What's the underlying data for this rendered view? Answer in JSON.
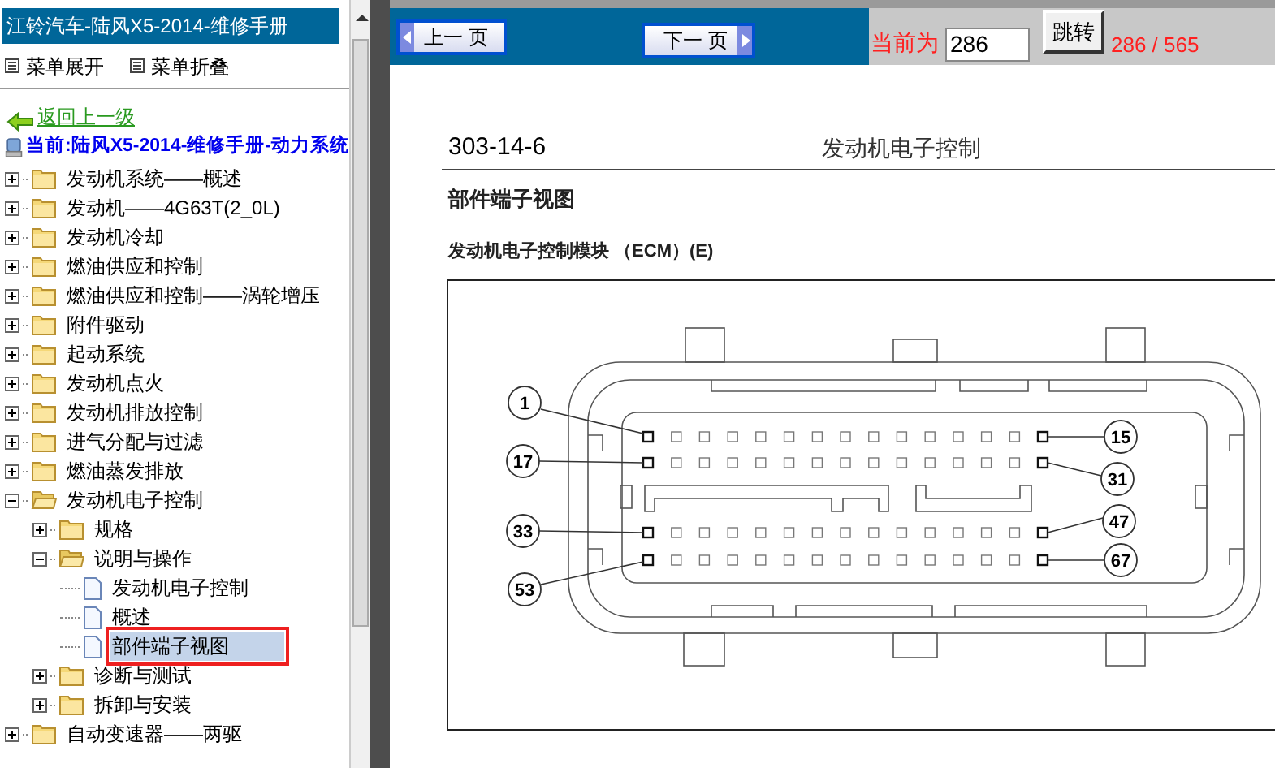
{
  "sidebar": {
    "title": "江铃汽车-陆风X5-2014-维修手册",
    "menu_actions": [
      {
        "label": "菜单展开"
      },
      {
        "label": "菜单折叠"
      }
    ],
    "back_link": "返回上一级",
    "current": "当前:陆风X5-2014-维修手册-动力系统",
    "tree": [
      {
        "kind": "folder",
        "label": "发动机系统——概述",
        "expanded": false,
        "selected": false
      },
      {
        "kind": "folder",
        "label": "发动机——4G63T(2_0L)",
        "expanded": false,
        "selected": false
      },
      {
        "kind": "folder",
        "label": "发动机冷却",
        "expanded": false,
        "selected": false
      },
      {
        "kind": "folder",
        "label": "燃油供应和控制",
        "expanded": false,
        "selected": false
      },
      {
        "kind": "folder",
        "label": "燃油供应和控制——涡轮增压",
        "expanded": false,
        "selected": false
      },
      {
        "kind": "folder",
        "label": "附件驱动",
        "expanded": false,
        "selected": false
      },
      {
        "kind": "folder",
        "label": "起动系统",
        "expanded": false,
        "selected": false
      },
      {
        "kind": "folder",
        "label": "发动机点火",
        "expanded": false,
        "selected": false
      },
      {
        "kind": "folder",
        "label": "发动机排放控制",
        "expanded": false,
        "selected": false
      },
      {
        "kind": "folder",
        "label": "进气分配与过滤",
        "expanded": false,
        "selected": false
      },
      {
        "kind": "folder",
        "label": "燃油蒸发排放",
        "expanded": false,
        "selected": false
      },
      {
        "kind": "folder",
        "label": "发动机电子控制",
        "expanded": true,
        "selected": false,
        "children": [
          {
            "kind": "folder",
            "label": "规格",
            "expanded": false,
            "selected": false
          },
          {
            "kind": "folder",
            "label": "说明与操作",
            "expanded": true,
            "selected": false,
            "children": [
              {
                "kind": "document",
                "label": "发动机电子控制",
                "selected": false
              },
              {
                "kind": "document",
                "label": "概述",
                "selected": false
              },
              {
                "kind": "document",
                "label": "部件端子视图",
                "selected": true
              }
            ]
          },
          {
            "kind": "folder",
            "label": "诊断与测试",
            "expanded": false,
            "selected": false
          },
          {
            "kind": "folder",
            "label": "拆卸与安装",
            "expanded": false,
            "selected": false
          }
        ]
      },
      {
        "kind": "folder",
        "label": "自动变速器——两驱",
        "expanded": false,
        "selected": false
      }
    ]
  },
  "toolbar": {
    "prev_button": "上一 页",
    "next_button": "下一 页",
    "current_label": "当前为",
    "page_input": "286",
    "jump_button": "跳转",
    "page_count": "286 / 565"
  },
  "document": {
    "section_number": "303-14-6",
    "header_title": "发动机电子控制",
    "heading": "部件端子视图",
    "subheading": "发动机电子控制模块 （ECM）(E)",
    "callouts": [
      "1",
      "17",
      "33",
      "53",
      "15",
      "31",
      "47",
      "67"
    ]
  }
}
